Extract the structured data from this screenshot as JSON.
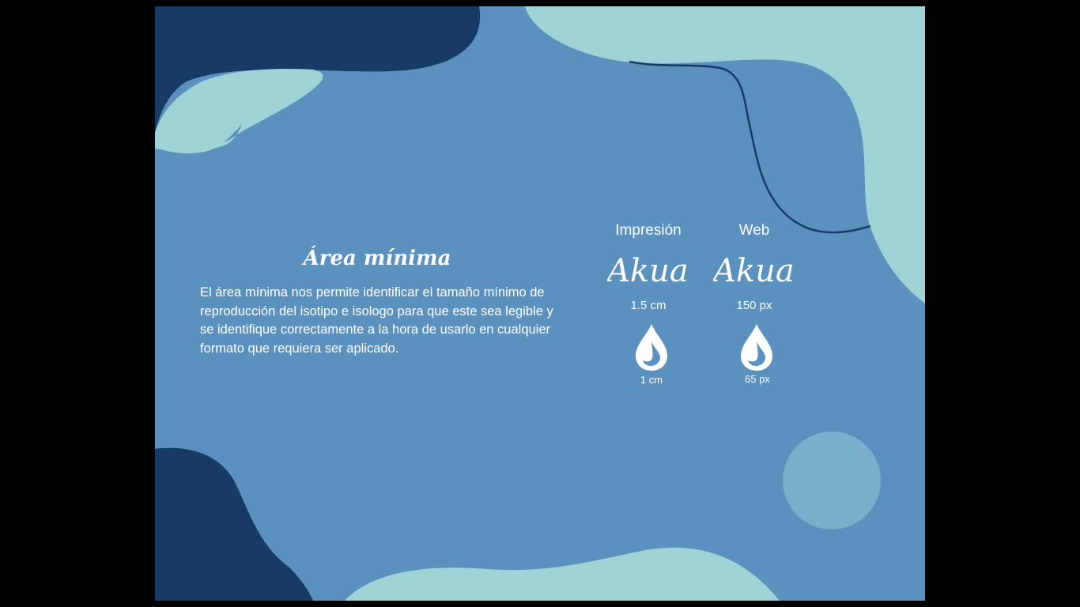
{
  "slide": {
    "title": "Área mínima",
    "description": "El área mínima nos permite identificar el tamaño mínimo de reproducción del isotipo e isologo para que este sea legible y se identifique correctamente a la hora de usarlo en cualquier formato que requiera ser aplicado."
  },
  "columns": [
    {
      "label": "Impresión",
      "logo_size": "1.5 cm",
      "icon_size": "1 cm"
    },
    {
      "label": "Web",
      "logo_size": "150 px",
      "icon_size": "65 px"
    }
  ],
  "logo": {
    "text": "Akua",
    "icon": "water-drop-icon"
  },
  "colors": {
    "background": "#5b91bf",
    "dark_blob": "#173a66",
    "light_blob": "#9fd3d5",
    "circle": "#79afc8",
    "text": "#ffffff"
  }
}
